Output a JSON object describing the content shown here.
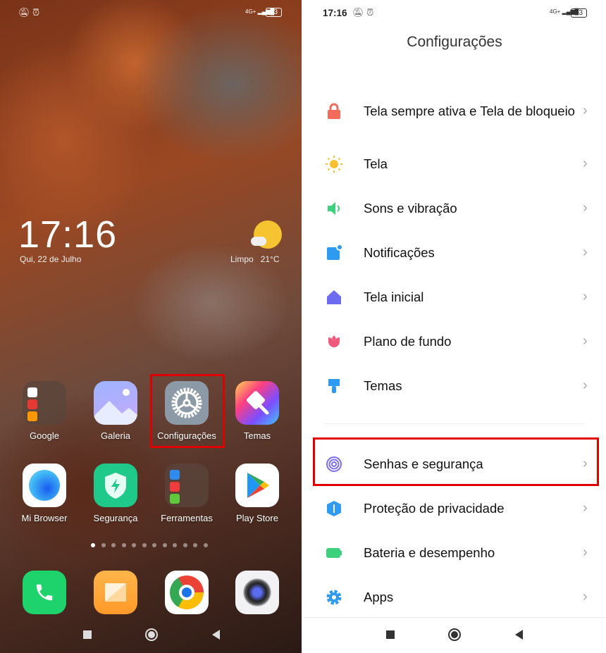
{
  "home": {
    "status": {
      "battery": "63",
      "network": "4G+"
    },
    "clock": "17:16",
    "date": "Qui, 22 de Julho",
    "weather": {
      "condition": "Limpo",
      "temp": "21°C"
    },
    "apps": [
      {
        "label": "Google"
      },
      {
        "label": "Galeria"
      },
      {
        "label": "Configurações"
      },
      {
        "label": "Temas"
      },
      {
        "label": "Mi Browser"
      },
      {
        "label": "Segurança"
      },
      {
        "label": "Ferramentas"
      },
      {
        "label": "Play Store"
      }
    ],
    "page_count": 12,
    "current_page": 1,
    "dock": [
      "phone",
      "messages",
      "chrome",
      "camera"
    ]
  },
  "settings": {
    "status": {
      "time": "17:16",
      "battery": "63",
      "network": "4G+"
    },
    "title": "Configurações",
    "items": [
      {
        "label": "Tela sempre ativa e Tela de bloqueio",
        "icon": "lock-icon",
        "color": "#f36b5b"
      },
      {
        "label": "Tela",
        "icon": "sun-icon",
        "color": "#f9c02f"
      },
      {
        "label": "Sons e vibração",
        "icon": "speaker-icon",
        "color": "#3ed17d"
      },
      {
        "label": "Notificações",
        "icon": "notification-icon",
        "color": "#2e9af0"
      },
      {
        "label": "Tela inicial",
        "icon": "home-icon",
        "color": "#6d6cf0"
      },
      {
        "label": "Plano de fundo",
        "icon": "flower-icon",
        "color": "#f0577a"
      },
      {
        "label": "Temas",
        "icon": "brush-icon",
        "color": "#2e9af0"
      },
      {
        "label": "Senhas e segurança",
        "icon": "fingerprint-icon",
        "color": "#7b6cf0"
      },
      {
        "label": "Proteção de privacidade",
        "icon": "privacy-icon",
        "color": "#2e9af0"
      },
      {
        "label": "Bateria e desempenho",
        "icon": "battery-icon",
        "color": "#3ed17d"
      },
      {
        "label": "Apps",
        "icon": "gear-icon",
        "color": "#2e9af0"
      }
    ]
  },
  "highlight_color": "#e00000"
}
